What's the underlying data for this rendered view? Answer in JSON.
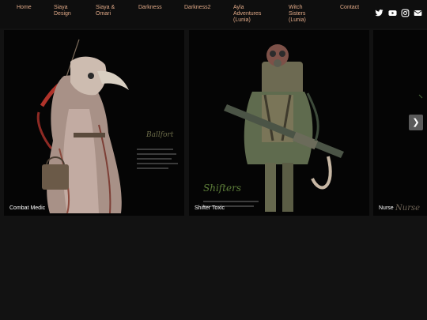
{
  "nav": {
    "items": [
      {
        "label": "Home"
      },
      {
        "label": "Siaya\nDesign"
      },
      {
        "label": "Siaya &\nOmari"
      },
      {
        "label": "Darkness"
      },
      {
        "label": "Darkness2"
      },
      {
        "label": "Ayla\nAdventures\n(Lunia)"
      },
      {
        "label": "Witch\nSisters\n(Lunia)"
      },
      {
        "label": "Contact"
      }
    ],
    "social": [
      "twitter-icon",
      "youtube-icon",
      "instagram-icon",
      "mail-icon"
    ]
  },
  "gallery": {
    "cards": [
      {
        "caption": "Combat Medic"
      },
      {
        "caption": "Shifter Toxic"
      },
      {
        "caption": "Nurse"
      }
    ],
    "next_label": "❯"
  },
  "colors": {
    "background": "#121212",
    "nav_link": "#e0a987",
    "caption": "#ffffff"
  }
}
